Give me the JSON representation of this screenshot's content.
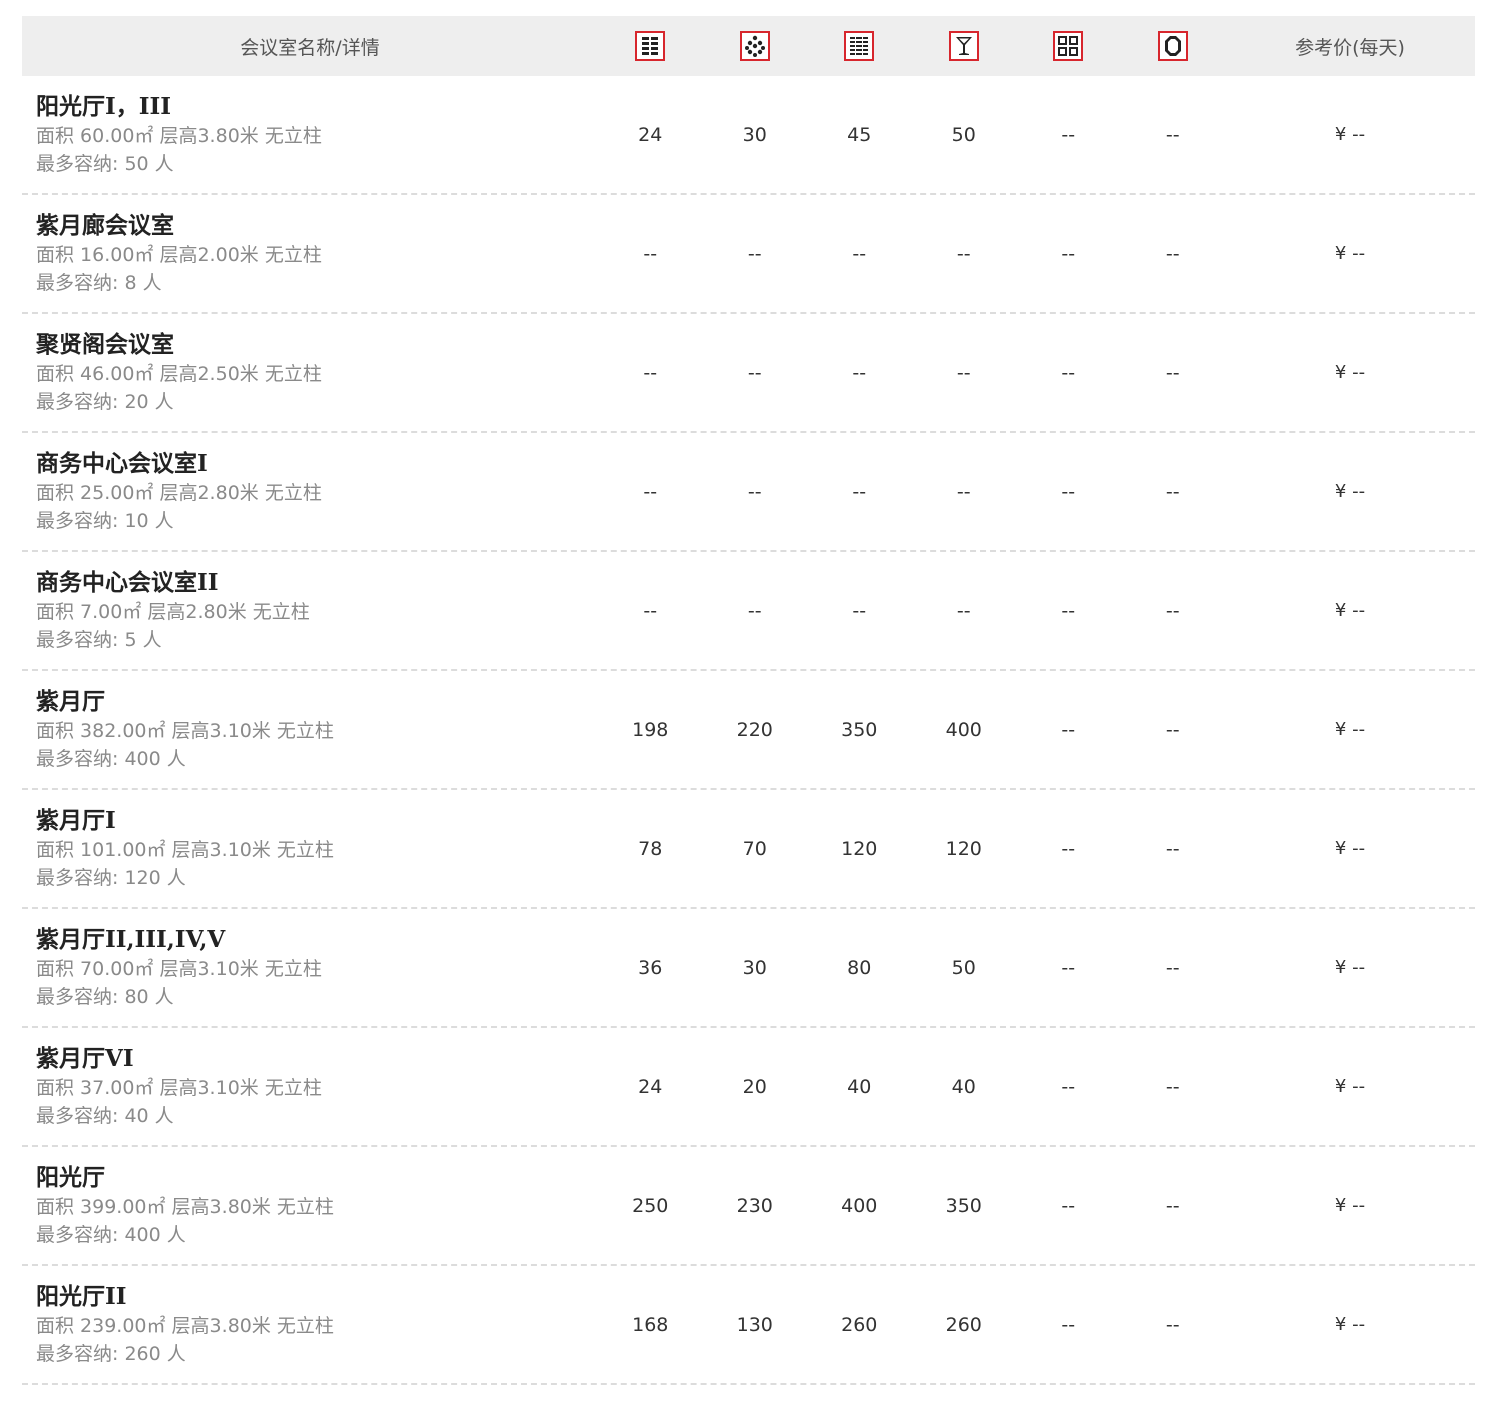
{
  "header": {
    "name_label": "会议室名称/详情",
    "price_label": "参考价(每天)",
    "icons": [
      "theater-layout-icon",
      "banquet-layout-icon",
      "classroom-layout-icon",
      "cocktail-layout-icon",
      "board-layout-icon",
      "u-shape-layout-icon"
    ]
  },
  "accent_color": "#d7262d",
  "rooms": [
    {
      "name": "阳光厅I，III",
      "detail": "面积 60.00㎡ 层高3.80米 无立柱",
      "capacity": "最多容纳: 50 人",
      "values": [
        "24",
        "30",
        "45",
        "50",
        "--",
        "--"
      ],
      "price": "¥ --"
    },
    {
      "name": "紫月廊会议室",
      "detail": "面积 16.00㎡ 层高2.00米 无立柱",
      "capacity": "最多容纳: 8 人",
      "values": [
        "--",
        "--",
        "--",
        "--",
        "--",
        "--"
      ],
      "price": "¥ --"
    },
    {
      "name": "聚贤阁会议室",
      "detail": "面积 46.00㎡ 层高2.50米 无立柱",
      "capacity": "最多容纳: 20 人",
      "values": [
        "--",
        "--",
        "--",
        "--",
        "--",
        "--"
      ],
      "price": "¥ --"
    },
    {
      "name": "商务中心会议室I",
      "detail": "面积 25.00㎡ 层高2.80米 无立柱",
      "capacity": "最多容纳: 10 人",
      "values": [
        "--",
        "--",
        "--",
        "--",
        "--",
        "--"
      ],
      "price": "¥ --"
    },
    {
      "name": "商务中心会议室II",
      "detail": "面积 7.00㎡ 层高2.80米 无立柱",
      "capacity": "最多容纳: 5 人",
      "values": [
        "--",
        "--",
        "--",
        "--",
        "--",
        "--"
      ],
      "price": "¥ --"
    },
    {
      "name": "紫月厅",
      "detail": "面积 382.00㎡ 层高3.10米 无立柱",
      "capacity": "最多容纳: 400 人",
      "values": [
        "198",
        "220",
        "350",
        "400",
        "--",
        "--"
      ],
      "price": "¥ --"
    },
    {
      "name": "紫月厅I",
      "detail": "面积 101.00㎡ 层高3.10米 无立柱",
      "capacity": "最多容纳: 120 人",
      "values": [
        "78",
        "70",
        "120",
        "120",
        "--",
        "--"
      ],
      "price": "¥ --"
    },
    {
      "name": "紫月厅II,III,IV,V",
      "detail": "面积 70.00㎡ 层高3.10米 无立柱",
      "capacity": "最多容纳: 80 人",
      "values": [
        "36",
        "30",
        "80",
        "50",
        "--",
        "--"
      ],
      "price": "¥ --"
    },
    {
      "name": "紫月厅VI",
      "detail": "面积 37.00㎡ 层高3.10米 无立柱",
      "capacity": "最多容纳: 40 人",
      "values": [
        "24",
        "20",
        "40",
        "40",
        "--",
        "--"
      ],
      "price": "¥ --"
    },
    {
      "name": "阳光厅",
      "detail": "面积 399.00㎡ 层高3.80米 无立柱",
      "capacity": "最多容纳: 400 人",
      "values": [
        "250",
        "230",
        "400",
        "350",
        "--",
        "--"
      ],
      "price": "¥ --"
    },
    {
      "name": "阳光厅II",
      "detail": "面积 239.00㎡ 层高3.80米 无立柱",
      "capacity": "最多容纳: 260 人",
      "values": [
        "168",
        "130",
        "260",
        "260",
        "--",
        "--"
      ],
      "price": "¥ --"
    }
  ]
}
